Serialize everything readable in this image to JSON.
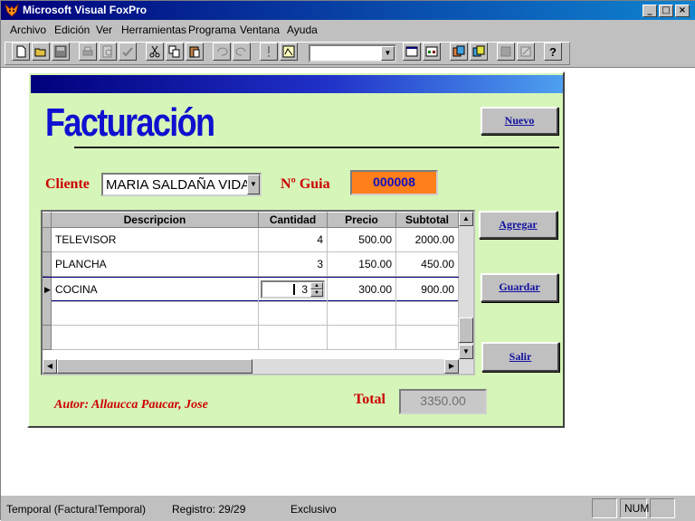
{
  "window": {
    "title": "Microsoft Visual FoxPro",
    "minimize": "_",
    "maximize": "□",
    "close": "×"
  },
  "menu": [
    "Archivo",
    "Edición",
    "Ver",
    "Herramientas",
    "Programa",
    "Ventana",
    "Ayuda"
  ],
  "form": {
    "title": "Facturación",
    "nuevo_label": "Nuevo",
    "agregar_label": "Agregar",
    "guardar_label": "Guardar",
    "salir_label": "Salir",
    "cliente_label": "Cliente",
    "cliente_value": "MARIA SALDAÑA VIDA",
    "guia_label": "Nº Guia",
    "guia_value": "000008",
    "total_label": "Total",
    "total_value": "3350.00",
    "autor": "Autor: Allaucca Paucar, Jose"
  },
  "grid": {
    "headers": [
      "Descripcion",
      "Cantidad",
      "Precio",
      "Subtotal"
    ],
    "rows": [
      {
        "descripcion": "TELEVISOR",
        "cantidad": "4",
        "precio": "500.00",
        "subtotal": "2000.00"
      },
      {
        "descripcion": "PLANCHA",
        "cantidad": "3",
        "precio": "150.00",
        "subtotal": "450.00"
      },
      {
        "descripcion": "COCINA",
        "cantidad": "3",
        "precio": "300.00",
        "subtotal": "900.00"
      }
    ]
  },
  "status": {
    "table": "Temporal (Factura!Temporal)",
    "registro": "Registro: 29/29",
    "mode": "Exclusivo",
    "num": "NUM"
  },
  "colors": {
    "title_blue": "#1010d0",
    "label_red": "#cc0000",
    "guia_bg": "#ff7f1a",
    "form_bg": "#d6f5b8"
  }
}
